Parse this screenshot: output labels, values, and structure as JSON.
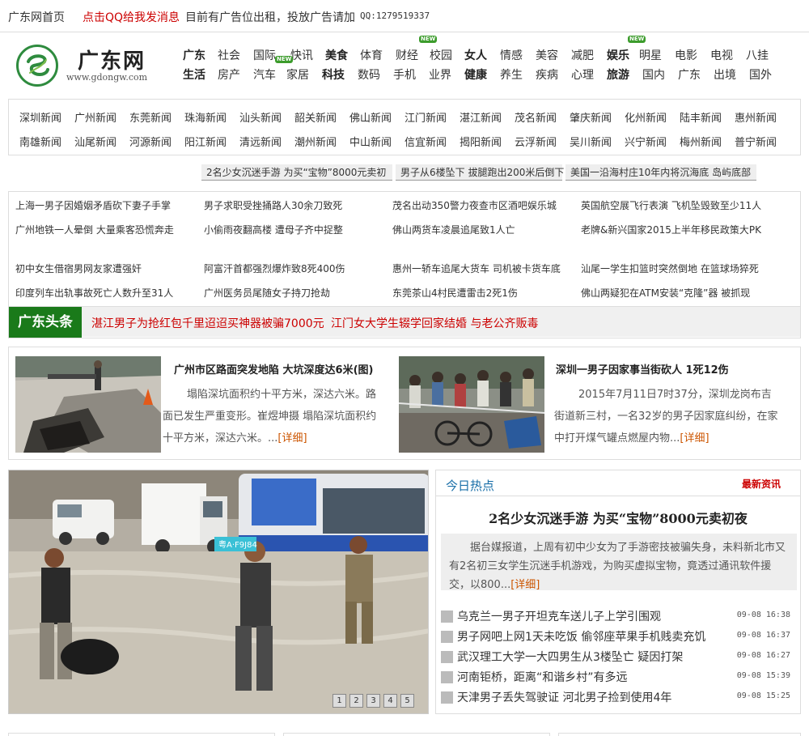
{
  "topbar": {
    "home": "广东网首页",
    "qq_msg": "点击QQ给我发消息",
    "ad": "目前有广告位出租，投放广告请加",
    "qq_num": "QQ:1279519337"
  },
  "logo": {
    "name": "广东网",
    "url": "www.gdongw.com"
  },
  "nav": {
    "row1": [
      "广东",
      "社会",
      "国际",
      "快讯",
      "美食",
      "体育",
      "财经",
      "校园",
      "女人",
      "情感",
      "美容",
      "减肥",
      "娱乐",
      "明星",
      "电影",
      "电视",
      "八挂"
    ],
    "row2": [
      "生活",
      "房产",
      "汽车",
      "家居",
      "科技",
      "数码",
      "手机",
      "业界",
      "健康",
      "养生",
      "疾病",
      "心理",
      "旅游",
      "国内",
      "广东",
      "出境",
      "国外"
    ],
    "new_label": "NEW"
  },
  "city_news": {
    "row1": [
      "深圳新闻",
      "广州新闻",
      "东莞新闻",
      "珠海新闻",
      "汕头新闻",
      "韶关新闻",
      "佛山新闻",
      "江门新闻",
      "湛江新闻",
      "茂名新闻",
      "肇庆新闻",
      "化州新闻",
      "陆丰新闻",
      "惠州新闻"
    ],
    "row2": [
      "南雄新闻",
      "汕尾新闻",
      "河源新闻",
      "阳江新闻",
      "清远新闻",
      "潮州新闻",
      "中山新闻",
      "信宜新闻",
      "揭阳新闻",
      "云浮新闻",
      "吴川新闻",
      "兴宁新闻",
      "梅州新闻",
      "普宁新闻"
    ]
  },
  "headline_strip": [
    "2名少女沉迷手游 为买“宝物”8000元卖初",
    "男子从6楼坠下 拔腿跑出200米后倒下",
    "美国一沿海村庄10年内将沉海底 岛屿底部"
  ],
  "news_grid": [
    [
      "上海一男子因婚姻矛盾砍下妻子手掌",
      "男子求职受挫捅路人30余刀致死",
      "茂名出动350警力夜查市区酒吧娱乐城",
      "英国航空展飞行表演 飞机坠毁致至少11人"
    ],
    [
      "广州地铁一人晕倒 大量乘客恐慌奔走",
      "小偷雨夜翻高楼 遭母子齐中捉整",
      "佛山两货车凌晨追尾致1人亡",
      "老牌&新兴国家2015上半年移民政策大PK"
    ],
    [
      "初中女生借宿男网友家遭强奸",
      "阿富汗首都强烈爆炸致8死400伤",
      "惠州一轿车追尾大货车 司机被卡货车底",
      "汕尾一学生扣篮时突然倒地 在篮球场猝死"
    ],
    [
      "印度列车出轨事故死亡人数升至31人",
      "广州医务员尾随女子持刀抢劫",
      "东莞茶山4村民遭雷击2死1伤",
      "佛山两疑犯在ATM安装“克隆”器 被抓现"
    ]
  ],
  "guangdong_top": {
    "label": "广东头条",
    "links": [
      "湛江男子为抢红包千里迢迢买神器被骗7000元",
      "江门女大学生辍学回家结婚 与老公齐贩毒"
    ]
  },
  "features": [
    {
      "title": "广州市区路面突发地陷 大坑深度达6米(图)",
      "body": "塌陷深坑面积约十平方米，深达六米。路面已发生严重变形。崔煜坤摄 塌陷深坑面积约十平方米，深达六米。...",
      "more": "[详细]"
    },
    {
      "title": "深圳一男子因家事当街砍人 1死12伤",
      "body": "2015年7月11日7时37分，深圳龙岗布吉街道新三村，一名32岁的男子因家庭纠纷，在家中打开煤气罐点燃屋内物...",
      "more": "[详细]"
    }
  ],
  "slideshow": {
    "pages": [
      "1",
      "2",
      "3",
      "4",
      "5"
    ],
    "plate_text": "粤A·F9J84"
  },
  "hot_today": {
    "title": "今日热点",
    "latest": "最新资讯",
    "main_title": "2名少女沉迷手游 为买“宝物”8000元卖初夜",
    "summary": "据台媒报道，上周有初中少女为了手游密技被骗失身，未料新北市又有2名初三女学生沉迷手机游戏，为购买虚拟宝物，竟透过通讯软件援交，以800...",
    "more": "[详细]",
    "items": [
      {
        "text": "乌克兰一男子开坦克车送儿子上学引围观",
        "time": "09-08 16:38"
      },
      {
        "text": "男子网吧上网1天未吃饭 偷邻座苹果手机贱卖充饥",
        "time": "09-08 16:37"
      },
      {
        "text": "武汉理工大学一大四男生从3楼坠亡 疑因打架",
        "time": "09-08 16:27"
      },
      {
        "text": "河南钜桥，距离“和谐乡村”有多远",
        "time": "09-08 15:39"
      },
      {
        "text": "天津男子丢失驾驶证 河北男子捡到使用4年",
        "time": "09-08 15:25"
      }
    ]
  },
  "colors": {
    "accent_red": "#cc0000",
    "brand_green": "#1a7a1a",
    "link_blue": "#1a6fa8"
  }
}
